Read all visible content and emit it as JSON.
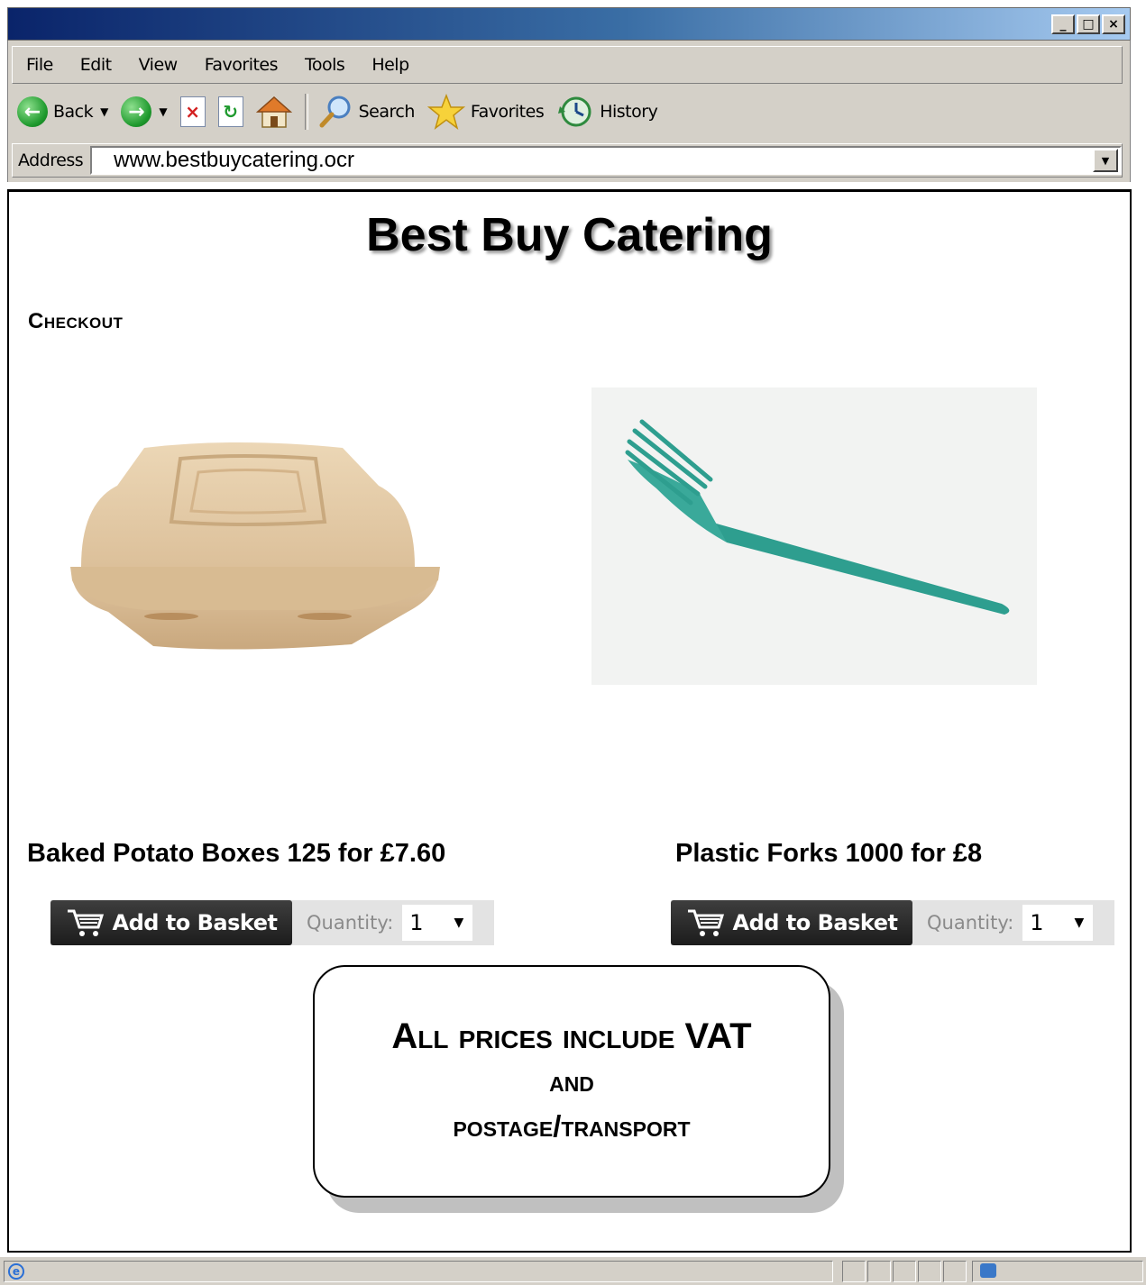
{
  "browser": {
    "window_controls": {
      "minimize": "_",
      "maximize": "□",
      "close": "×"
    },
    "menu": [
      "File",
      "Edit",
      "View",
      "Favorites",
      "Tools",
      "Help"
    ],
    "toolbar": {
      "back": "Back",
      "search": "Search",
      "favorites": "Favorites",
      "history": "History"
    },
    "address": {
      "label": "Address",
      "value": "www.bestbuycatering.ocr"
    }
  },
  "page": {
    "site_title": "Best Buy Catering",
    "section_heading": "Checkout",
    "products": [
      {
        "title": "Baked Potato Boxes 125 for £7.60",
        "button_label": "Add to Basket",
        "quantity_label": "Quantity:",
        "quantity_value": "1"
      },
      {
        "title": "Plastic Forks 1000 for £8",
        "button_label": "Add to Basket",
        "quantity_label": "Quantity:",
        "quantity_value": "1"
      }
    ],
    "notice": {
      "line1": "All prices include VAT",
      "line2": "and",
      "line3": "postage/transport"
    }
  },
  "colors": {
    "title_bar_start": "#0a246a",
    "chrome": "#d4d0c8",
    "basket_button": "#2a2a2a",
    "fork": "#2e9e8f",
    "box": "#e2c8a2"
  }
}
